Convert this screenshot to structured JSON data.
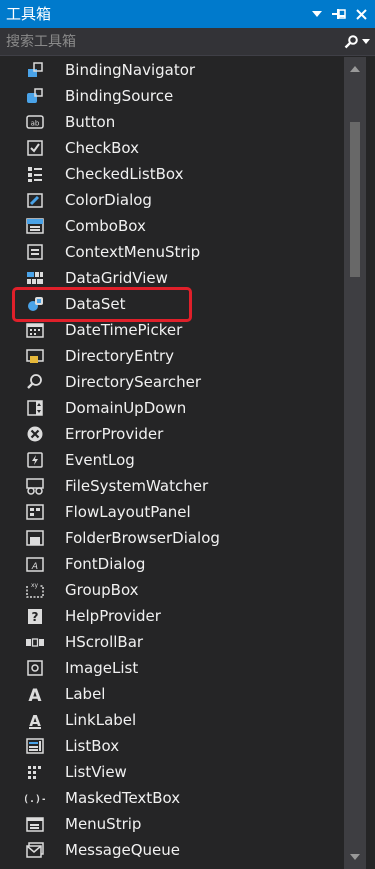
{
  "window": {
    "title": "工具箱"
  },
  "search": {
    "placeholder": "搜索工具箱"
  },
  "colors": {
    "accent": "#007acc",
    "background": "#252526",
    "text": "#f1f1f1",
    "highlight_border": "#e0202a",
    "icon": "#dcdcdc",
    "icon_blue": "#4aa3e8"
  },
  "toolbox": {
    "items": [
      {
        "label": "BindingNavigator",
        "icon": "binding-navigator-icon"
      },
      {
        "label": "BindingSource",
        "icon": "binding-source-icon"
      },
      {
        "label": "Button",
        "icon": "button-icon"
      },
      {
        "label": "CheckBox",
        "icon": "checkbox-icon"
      },
      {
        "label": "CheckedListBox",
        "icon": "checked-list-box-icon"
      },
      {
        "label": "ColorDialog",
        "icon": "color-dialog-icon"
      },
      {
        "label": "ComboBox",
        "icon": "combo-box-icon"
      },
      {
        "label": "ContextMenuStrip",
        "icon": "context-menu-strip-icon"
      },
      {
        "label": "DataGridView",
        "icon": "data-grid-view-icon"
      },
      {
        "label": "DataSet",
        "icon": "dataset-icon",
        "highlighted": true
      },
      {
        "label": "DateTimePicker",
        "icon": "date-time-picker-icon"
      },
      {
        "label": "DirectoryEntry",
        "icon": "directory-entry-icon"
      },
      {
        "label": "DirectorySearcher",
        "icon": "directory-searcher-icon"
      },
      {
        "label": "DomainUpDown",
        "icon": "domain-up-down-icon"
      },
      {
        "label": "ErrorProvider",
        "icon": "error-provider-icon"
      },
      {
        "label": "EventLog",
        "icon": "event-log-icon"
      },
      {
        "label": "FileSystemWatcher",
        "icon": "file-system-watcher-icon"
      },
      {
        "label": "FlowLayoutPanel",
        "icon": "flow-layout-panel-icon"
      },
      {
        "label": "FolderBrowserDialog",
        "icon": "folder-browser-dialog-icon"
      },
      {
        "label": "FontDialog",
        "icon": "font-dialog-icon"
      },
      {
        "label": "GroupBox",
        "icon": "group-box-icon"
      },
      {
        "label": "HelpProvider",
        "icon": "help-provider-icon"
      },
      {
        "label": "HScrollBar",
        "icon": "hscrollbar-icon"
      },
      {
        "label": "ImageList",
        "icon": "image-list-icon"
      },
      {
        "label": "Label",
        "icon": "label-icon"
      },
      {
        "label": "LinkLabel",
        "icon": "link-label-icon"
      },
      {
        "label": "ListBox",
        "icon": "list-box-icon"
      },
      {
        "label": "ListView",
        "icon": "list-view-icon"
      },
      {
        "label": "MaskedTextBox",
        "icon": "masked-text-box-icon"
      },
      {
        "label": "MenuStrip",
        "icon": "menu-strip-icon"
      },
      {
        "label": "MessageQueue",
        "icon": "message-queue-icon"
      }
    ]
  }
}
